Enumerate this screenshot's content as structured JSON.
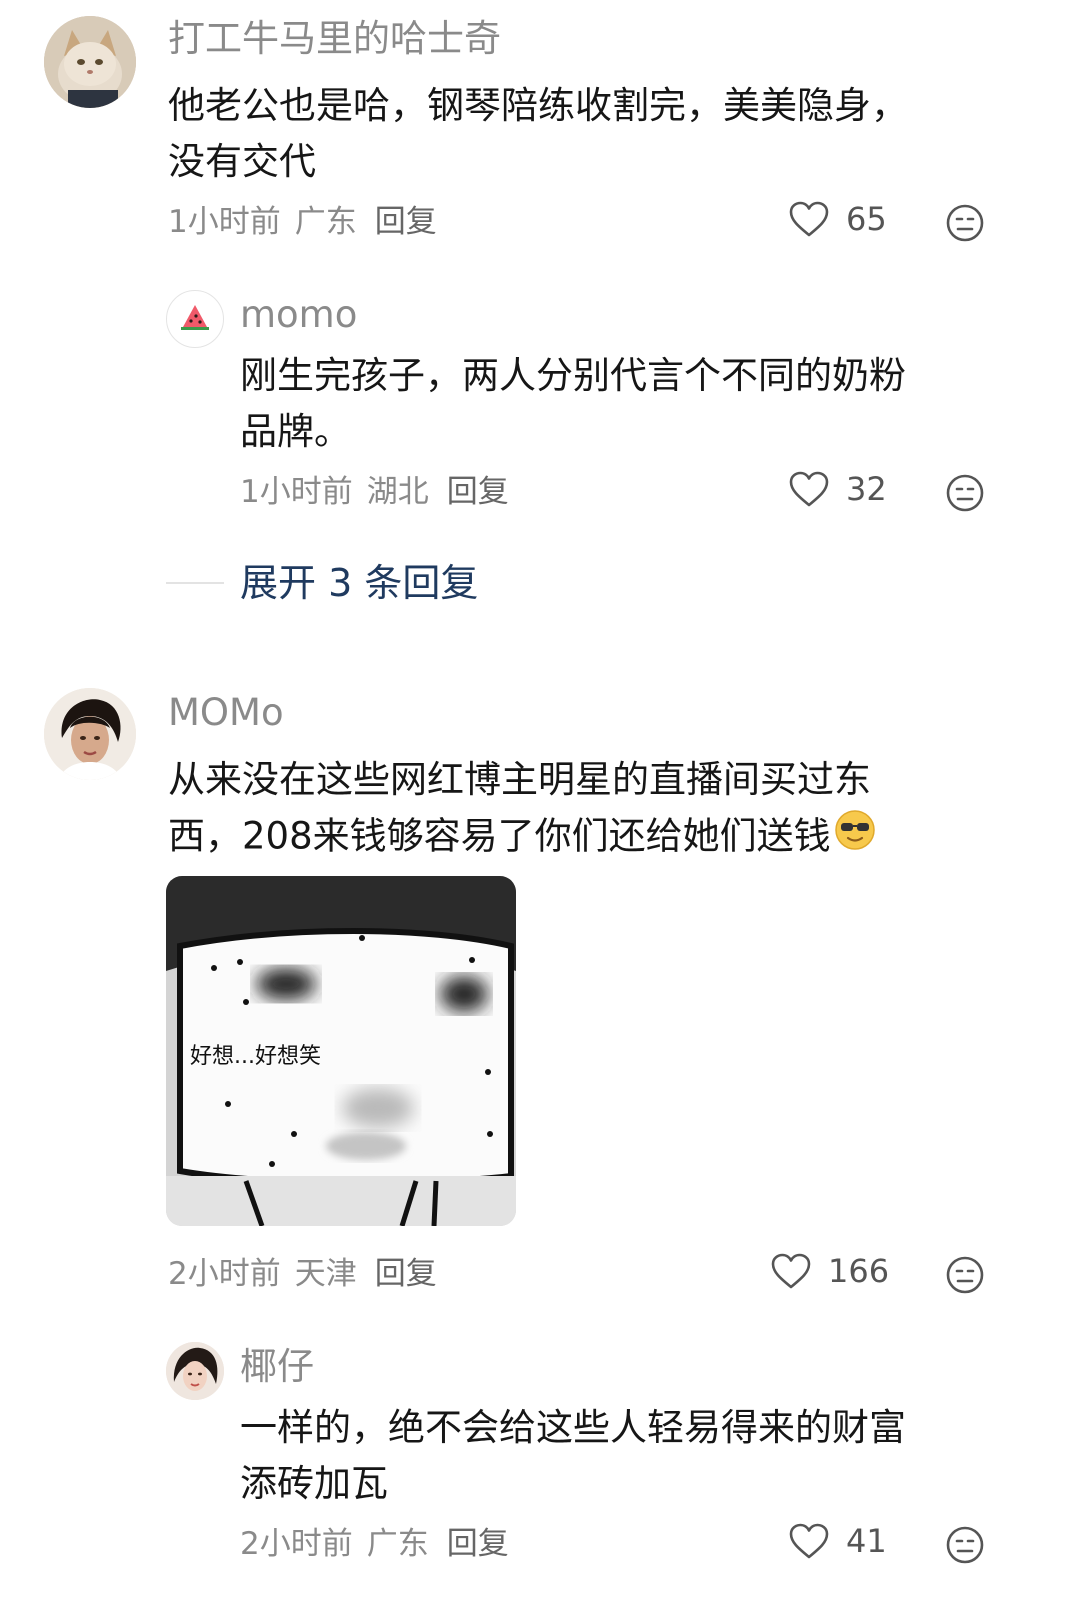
{
  "comments": [
    {
      "name": "打工牛马里的哈士奇",
      "lines": [
        "他老公也是哈，钢琴陪练收割完，美美隐身，",
        "没有交代"
      ],
      "time": "1小时前",
      "location": "广东",
      "reply_label": "回复",
      "likes": "65",
      "avatar_icon": "cat-avatar"
    },
    {
      "name": "momo",
      "lines": [
        "刚生完孩子，两人分别代言个不同的奶粉",
        "品牌。"
      ],
      "time": "1小时前",
      "location": "湖北",
      "reply_label": "回复",
      "likes": "32",
      "avatar_icon": "watermelon-avatar"
    },
    {
      "name": "MOMo",
      "lines": [
        "从来没在这些网红博主明星的直播间买过东",
        "西，208来钱够容易了你们还给她们送钱"
      ],
      "time": "2小时前",
      "location": "天津",
      "reply_label": "回复",
      "likes": "166",
      "sticker_caption": "好想...好想笑",
      "avatar_icon": "woman-portrait-avatar"
    },
    {
      "name": "椰仔",
      "lines": [
        "一样的，绝不会给这些人轻易得来的财富",
        "添砖加瓦"
      ],
      "time": "2小时前",
      "location": "广东",
      "reply_label": "回复",
      "likes": "41",
      "avatar_icon": "girl-portrait-avatar"
    }
  ],
  "expand": {
    "label": "展开 3 条回复"
  },
  "colors": {
    "name": "#8a8a8a",
    "text": "#161616",
    "meta": "#8a8a8a",
    "expand": "#1f3a5f"
  }
}
